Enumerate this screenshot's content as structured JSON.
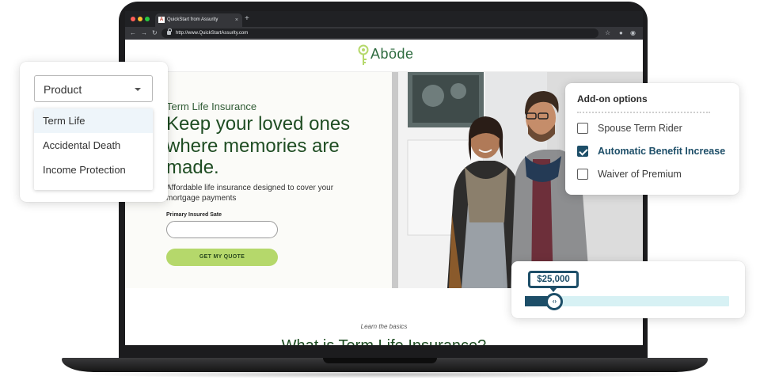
{
  "browser": {
    "tab_title": "QuickStart from Assurity",
    "tab_favicon_letter": "A",
    "tab_close": "×",
    "new_tab": "+",
    "url": "http://www.QuickStartAssurity.com",
    "back_icon": "←",
    "forward_icon": "→",
    "reload_icon": "↻",
    "star_icon": "☆",
    "profile_icon": "●",
    "menu_icon": "◉"
  },
  "site": {
    "logo_text": "Abōde",
    "hero": {
      "eyebrow": "Term Life Insurance",
      "headline": "Keep your loved ones where memories are made.",
      "subcopy": "Affordable life insurance designed to cover your mortgage payments",
      "field_label": "Primary Insured Sate",
      "field_value": "",
      "cta_label": "GET MY QUOTE"
    },
    "learn_label": "Learn the basics",
    "section_title": "What is Term Life Insurance?"
  },
  "product_dropdown": {
    "selected": "Product",
    "options": [
      "Term Life",
      "Accidental Death",
      "Income Protection"
    ],
    "highlighted_index": 0
  },
  "addons": {
    "title": "Add-on options",
    "options": [
      {
        "label": "Spouse Term Rider",
        "checked": false
      },
      {
        "label": "Automatic Benefit Increase",
        "checked": true
      },
      {
        "label": "Waiver of Premium",
        "checked": false
      }
    ]
  },
  "coverage_slider": {
    "value_label": "$25,000",
    "fill_fraction": 0.145,
    "thumb_glyph": "‹›"
  },
  "colors": {
    "brand_green": "#1f4d23",
    "cta_green": "#b5d86b",
    "accent_navy": "#1d4e68",
    "slider_track": "#d7f1f4"
  }
}
